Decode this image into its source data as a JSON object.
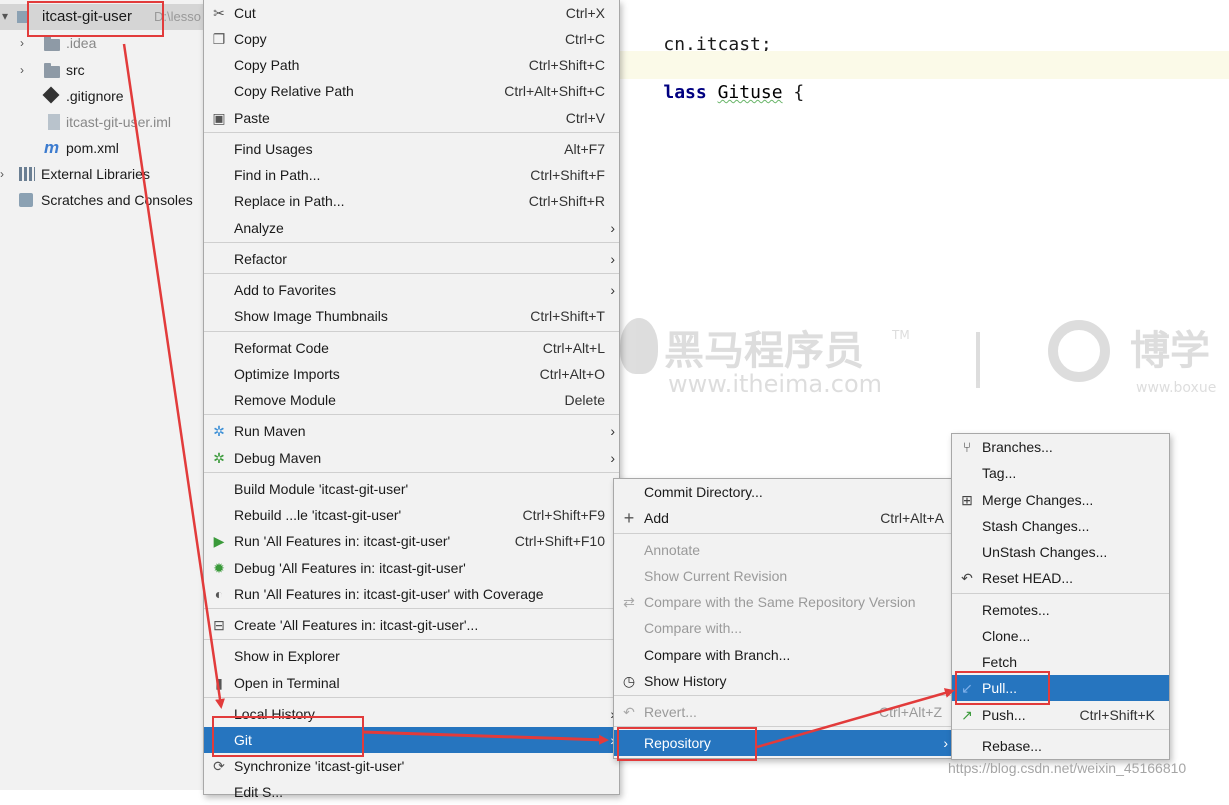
{
  "project_tree": {
    "root": {
      "label": "itcast-git-user",
      "path": "D:\\lesso"
    },
    "items": [
      {
        "label": ".idea",
        "type": "folder",
        "icon": "folder-icon",
        "collapsed": true
      },
      {
        "label": "src",
        "type": "folder",
        "icon": "folder-icon",
        "collapsed": true
      },
      {
        "label": ".gitignore",
        "type": "file",
        "icon": "git-file-icon"
      },
      {
        "label": "itcast-git-user.iml",
        "type": "file",
        "icon": "iml-file-icon"
      },
      {
        "label": "pom.xml",
        "type": "file",
        "icon": "maven-m-icon"
      },
      {
        "label": "External Libraries",
        "type": "group",
        "icon": "libraries-icon"
      },
      {
        "label": "Scratches and Consoles",
        "type": "group",
        "icon": "scratches-icon"
      }
    ]
  },
  "editor": {
    "line1": "cn.itcast;",
    "line2_kw": "lass",
    "line2_name": "Gituse",
    "line2_rest": " {"
  },
  "watermark": {
    "brand_cn": "黑马程序员",
    "tm": "TM",
    "url": "www.itheima.com",
    "brand2_cn": "博学",
    "url2": "www.boxue"
  },
  "context_menu": {
    "items": [
      {
        "label": "Cut",
        "shortcut": "Ctrl+X",
        "icon": "scissors-icon"
      },
      {
        "label": "Copy",
        "shortcut": "Ctrl+C",
        "icon": "copy-icon"
      },
      {
        "label": "Copy Path",
        "shortcut": "Ctrl+Shift+C"
      },
      {
        "label": "Copy Relative Path",
        "shortcut": "Ctrl+Alt+Shift+C"
      },
      {
        "label": "Paste",
        "shortcut": "Ctrl+V",
        "icon": "paste-icon"
      },
      {
        "label": "Find Usages",
        "shortcut": "Alt+F7"
      },
      {
        "label": "Find in Path...",
        "shortcut": "Ctrl+Shift+F"
      },
      {
        "label": "Replace in Path...",
        "shortcut": "Ctrl+Shift+R"
      },
      {
        "label": "Analyze",
        "submenu": true
      },
      {
        "label": "Refactor",
        "submenu": true
      },
      {
        "label": "Add to Favorites",
        "submenu": true
      },
      {
        "label": "Show Image Thumbnails",
        "shortcut": "Ctrl+Shift+T"
      },
      {
        "label": "Reformat Code",
        "shortcut": "Ctrl+Alt+L"
      },
      {
        "label": "Optimize Imports",
        "shortcut": "Ctrl+Alt+O"
      },
      {
        "label": "Remove Module",
        "shortcut": "Delete"
      },
      {
        "label": "Run Maven",
        "submenu": true,
        "icon": "maven-gear-icon"
      },
      {
        "label": "Debug Maven",
        "submenu": true,
        "icon": "maven-debug-icon"
      },
      {
        "label": "Build Module 'itcast-git-user'"
      },
      {
        "label": "Rebuild ...le 'itcast-git-user'",
        "shortcut": "Ctrl+Shift+F9"
      },
      {
        "label": "Run 'All Features in: itcast-git-user'",
        "shortcut": "Ctrl+Shift+F10",
        "icon": "run-icon"
      },
      {
        "label": "Debug 'All Features in: itcast-git-user'",
        "icon": "debug-icon"
      },
      {
        "label": "Run 'All Features in: itcast-git-user' with Coverage",
        "icon": "coverage-icon"
      },
      {
        "label": "Create 'All Features in: itcast-git-user'...",
        "icon": "create-config-icon"
      },
      {
        "label": "Show in Explorer"
      },
      {
        "label": "Open in Terminal",
        "icon": "terminal-icon"
      },
      {
        "label": "Local History",
        "submenu": true
      },
      {
        "label": "Git",
        "submenu": true,
        "selected": true
      },
      {
        "label": "Synchronize 'itcast-git-user'",
        "icon": "sync-icon"
      },
      {
        "label": "Edit S..."
      }
    ]
  },
  "git_menu": {
    "items": [
      {
        "label": "Commit Directory..."
      },
      {
        "label": "Add",
        "shortcut": "Ctrl+Alt+A",
        "icon": "plus-icon"
      },
      {
        "label": "Annotate",
        "disabled": true
      },
      {
        "label": "Show Current Revision",
        "disabled": true
      },
      {
        "label": "Compare with the Same Repository Version",
        "disabled": true,
        "icon": "compare-icon"
      },
      {
        "label": "Compare with...",
        "disabled": true
      },
      {
        "label": "Compare with Branch..."
      },
      {
        "label": "Show History",
        "icon": "clock-icon"
      },
      {
        "label": "Revert...",
        "shortcut": "Ctrl+Alt+Z",
        "disabled": true,
        "icon": "revert-icon"
      },
      {
        "label": "Repository",
        "submenu": true,
        "selected": true
      }
    ]
  },
  "repository_menu": {
    "items": [
      {
        "label": "Branches...",
        "icon": "branch-icon"
      },
      {
        "label": "Tag..."
      },
      {
        "label": "Merge Changes...",
        "icon": "merge-icon"
      },
      {
        "label": "Stash Changes..."
      },
      {
        "label": "UnStash Changes..."
      },
      {
        "label": "Reset HEAD...",
        "icon": "undo-icon"
      },
      {
        "label": "Remotes..."
      },
      {
        "label": "Clone..."
      },
      {
        "label": "Fetch"
      },
      {
        "label": "Pull...",
        "selected": true,
        "icon": "pull-arrow-icon"
      },
      {
        "label": "Push...",
        "shortcut": "Ctrl+Shift+K",
        "icon": "push-arrow-icon"
      },
      {
        "label": "Rebase..."
      }
    ]
  },
  "footer_watermark": "https://blog.csdn.net/weixin_45166810",
  "colors": {
    "selection": "#2675bf",
    "annotation": "#e23b3b",
    "menu_bg": "#f2f2f2"
  }
}
